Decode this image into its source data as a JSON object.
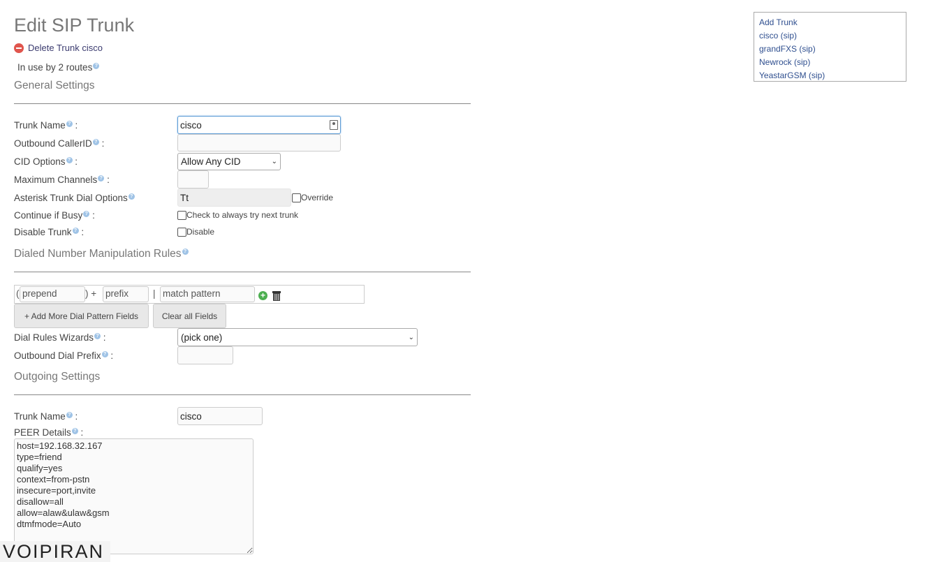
{
  "page": {
    "title": "Edit SIP Trunk",
    "delete_label": "Delete Trunk cisco",
    "in_use": "In use by 2 routes",
    "help_glyph": "?"
  },
  "sections": {
    "general": "General Settings",
    "dial_rules": "Dialed Number Manipulation Rules",
    "outgoing": "Outgoing Settings"
  },
  "general": {
    "trunk_name_label": "Trunk Name",
    "trunk_name_value": "cisco",
    "outbound_cid_label": "Outbound CallerID",
    "outbound_cid_value": "",
    "cid_options_label": "CID Options",
    "cid_options_value": "Allow Any CID",
    "max_channels_label": "Maximum Channels",
    "max_channels_value": "",
    "dial_options_label": "Asterisk Trunk Dial Options",
    "dial_options_value": "Tt",
    "override_label": "Override",
    "continue_busy_label": "Continue if Busy",
    "continue_busy_cb_label": "Check to always try next trunk",
    "disable_trunk_label": "Disable Trunk",
    "disable_cb_label": "Disable",
    "colon": ":"
  },
  "dial_pattern": {
    "open_paren": "(",
    "close_plus": ") +",
    "pipe": "|",
    "prepend_placeholder": "prepend",
    "prefix_placeholder": "prefix",
    "match_placeholder": "match pattern",
    "add_more_label": "+ Add More Dial Pattern Fields",
    "clear_label": "Clear all Fields",
    "wizards_label": "Dial Rules Wizards",
    "wizards_value": "(pick one)",
    "outbound_prefix_label": "Outbound Dial Prefix",
    "outbound_prefix_value": ""
  },
  "outgoing": {
    "trunk_name_label": "Trunk Name",
    "trunk_name_value": "cisco",
    "peer_label": "PEER Details",
    "peer_details": "host=192.168.32.167\ntype=friend\nqualify=yes\ncontext=from-pstn\ninsecure=port,invite\ndisallow=all\nallow=alaw&ulaw&gsm\ndtmfmode=Auto"
  },
  "trunk_list": {
    "items": [
      "Add Trunk",
      "cisco (sip)",
      "grandFXS (sip)",
      "Newrock (sip)",
      "YeastarGSM (sip)"
    ]
  },
  "logo": {
    "text": "VOIPIRAN"
  },
  "colors": {
    "link": "#2f4f8f",
    "delete": "#e0554d",
    "add": "#4caf50",
    "focus": "#5b9bd5"
  },
  "icons": {
    "delete": "minus-circle-icon",
    "add": "plus-circle-icon",
    "trash": "trash-icon",
    "help": "question-circle-icon",
    "autofill": "contact-card-icon"
  }
}
